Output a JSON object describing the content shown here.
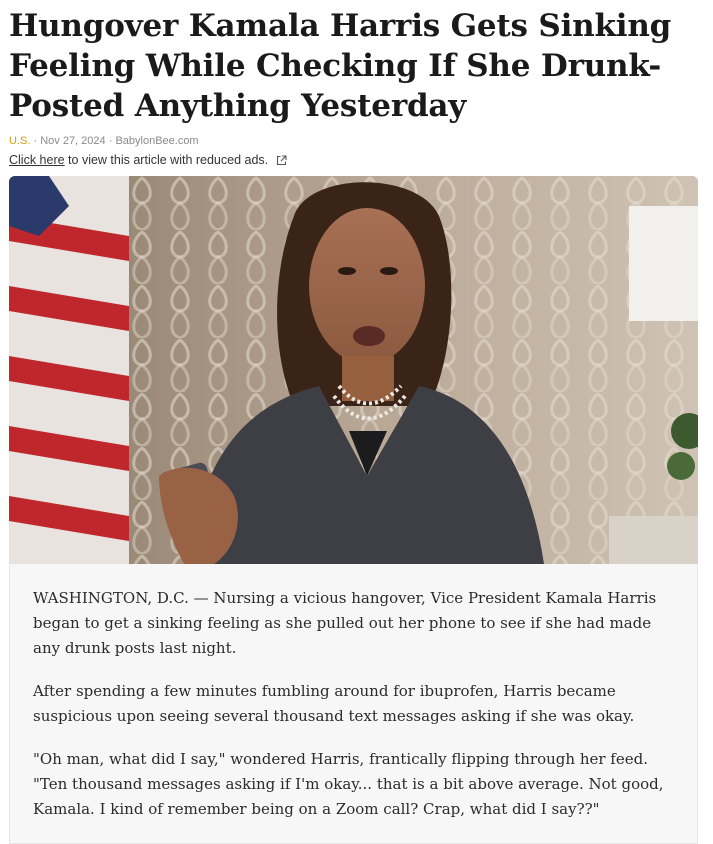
{
  "article": {
    "title": "Hungover Kamala Harris Gets Sinking Feeling While Checking If She Drunk-Posted Anything Yesterday",
    "category": "U.S.",
    "date": "Nov 27, 2024",
    "source": "BabylonBee.com",
    "meta_separator": "·",
    "reduced_ads_link": "Click here",
    "reduced_ads_text": " to view this article with reduced ads.",
    "paragraphs": [
      "WASHINGTON, D.C. — Nursing a vicious hangover, Vice President Kamala Harris began to get a sinking feeling as she pulled out her phone to see if she had made any drunk posts last night.",
      "After spending a few minutes fumbling around for ibuprofen, Harris became suspicious upon seeing several thousand text messages asking if she was okay.",
      "\"Oh man, what did I say,\" wondered Harris, frantically flipping through her feed. \"Ten thousand messages asking if I'm okay... that is a bit above average. Not good, Kamala. I kind of remember being on a Zoom call? Crap, what did I say??\""
    ]
  },
  "icons": {
    "external_link": "external-link-icon"
  },
  "colors": {
    "category": "#d4a017",
    "meta": "#8a8a8a",
    "card_bg": "#f7f7f7"
  }
}
